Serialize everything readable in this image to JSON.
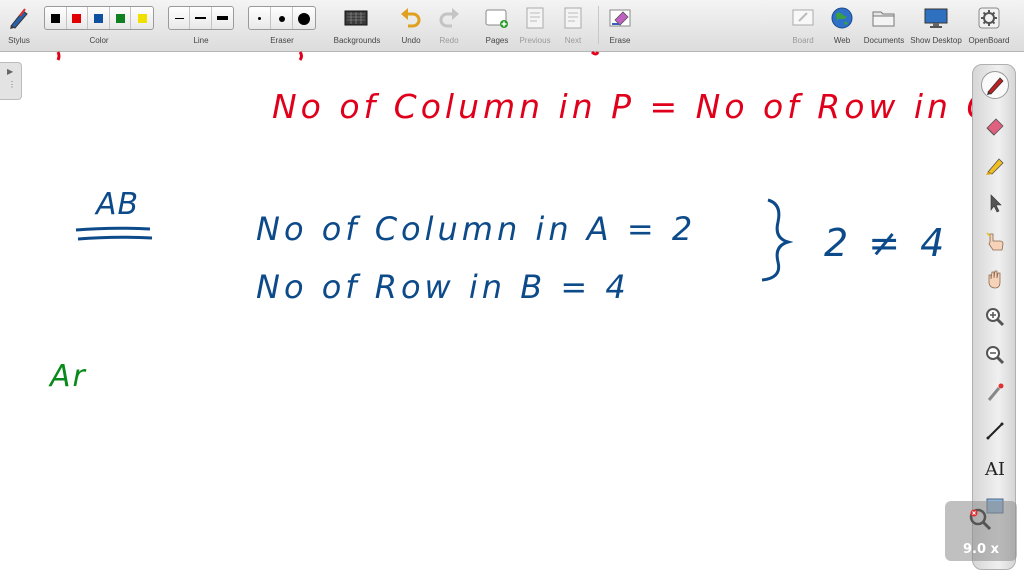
{
  "app": "OpenBoard",
  "colors": {
    "red_ink": "#e0001b",
    "blue_ink": "#0d4a8a",
    "green_ink": "#0a8a1a"
  },
  "toolbar": {
    "stylus": "Stylus",
    "color": "Color",
    "line": "Line",
    "eraser": "Eraser",
    "backgrounds": "Backgrounds",
    "undo": "Undo",
    "redo": "Redo",
    "pages": "Pages",
    "previous": "Previous",
    "next": "Next",
    "erase": "Erase",
    "board": "Board",
    "web": "Web",
    "documents": "Documents",
    "show_desktop": "Show Desktop",
    "openboard": "OpenBoard",
    "color_swatches": [
      "#000000",
      "#e00000",
      "#1050a0",
      "#108020",
      "#f0e000"
    ]
  },
  "zoom": {
    "level": "9.0 x"
  },
  "handwriting": {
    "line1": "No of Column in P = No of Row in Q",
    "heading": "AB",
    "line2": "No of Column in A = 2",
    "line3": "No of Row in B = 4",
    "result": "2 ≠ 4",
    "line4": "Ar"
  }
}
